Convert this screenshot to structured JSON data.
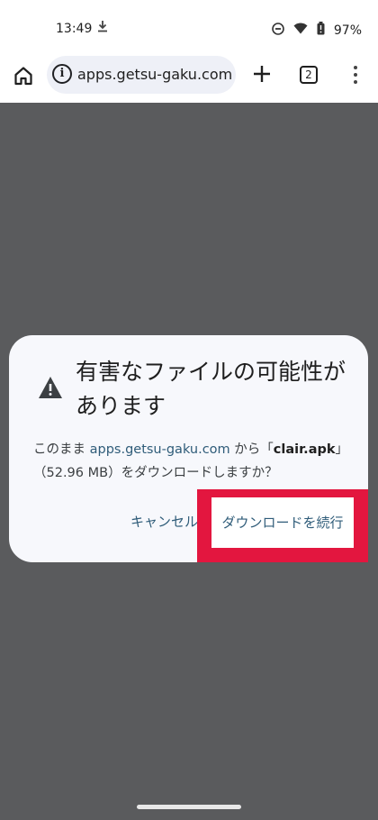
{
  "status_bar": {
    "time": "13:49",
    "download_icon": "download-icon",
    "dnd_icon": "do-not-disturb-icon",
    "wifi_icon": "wifi-icon",
    "battery_icon": "battery-icon",
    "battery": "97%"
  },
  "toolbar": {
    "home_icon": "home-icon",
    "info_icon": "info-icon",
    "url": "apps.getsu-gaku.com",
    "new_tab_icon": "plus-icon",
    "tab_count": "2",
    "menu_icon": "more-vert-icon"
  },
  "dialog": {
    "warning_icon": "warning-icon",
    "title": "有害なファイルの可能性があります",
    "body_prefix": "このまま ",
    "domain": "apps.getsu-gaku.com",
    "body_mid": " から「",
    "file_name": "clair.apk",
    "body_suffix": "」（52.96 MB）をダウンロードしますか？",
    "cancel_label": "キャンセル",
    "continue_label": "ダウンロードを続行"
  },
  "colors": {
    "scrim": "#5a5b5d",
    "dialog_bg": "#f7f8fc",
    "accent": "#2f5c79",
    "highlight": "#e3163f"
  }
}
